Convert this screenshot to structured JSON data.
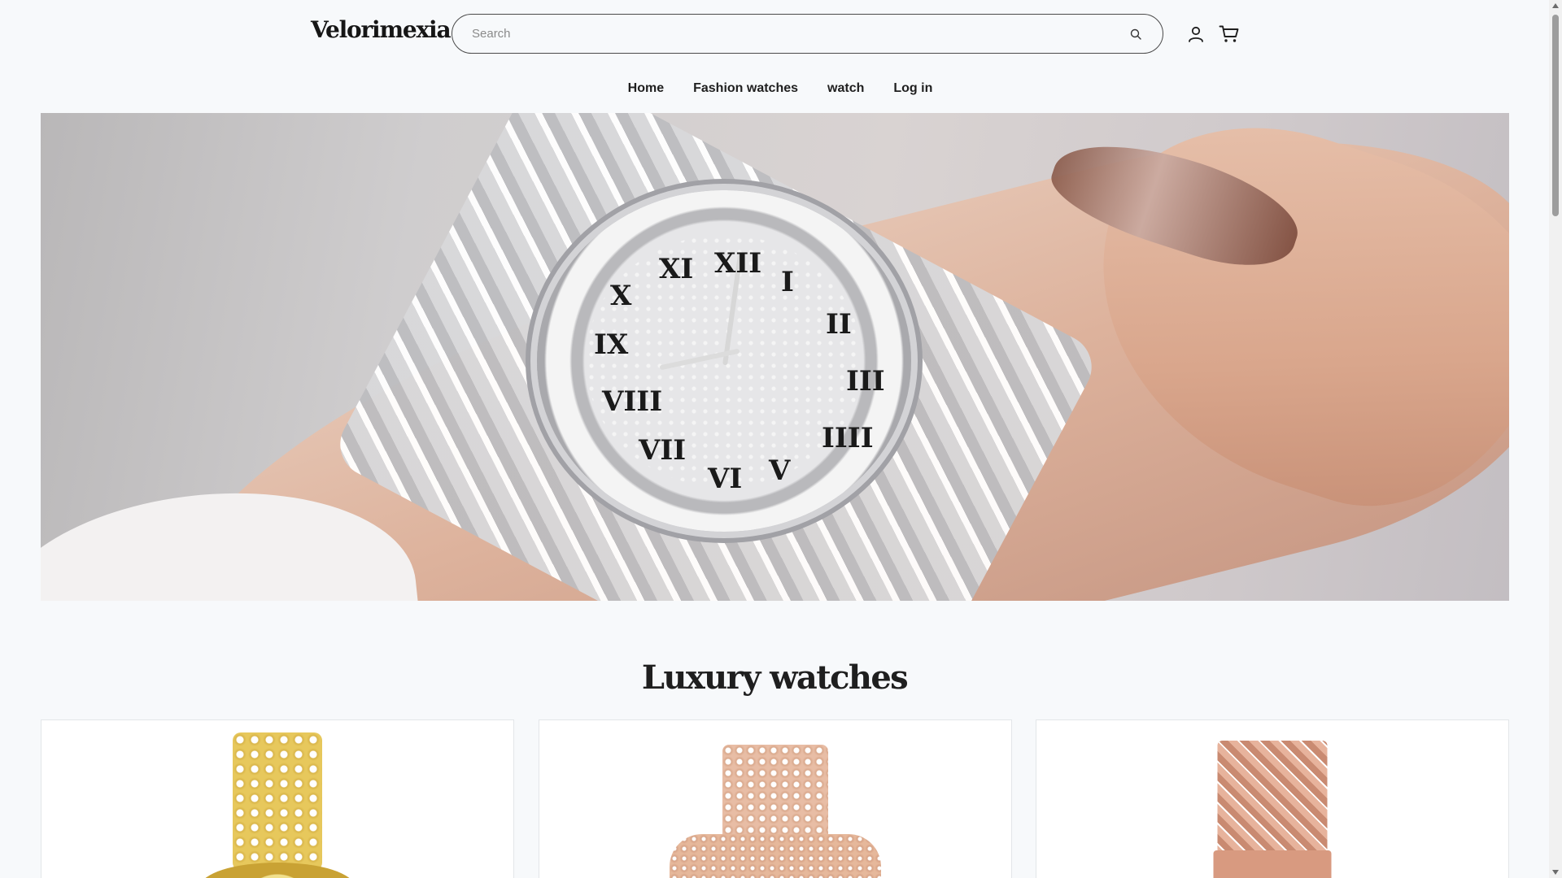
{
  "brand": {
    "logo_text": "Velorimexia"
  },
  "search": {
    "placeholder": "Search",
    "value": "",
    "icon": "search-icon"
  },
  "header_icons": {
    "account": "user-icon",
    "cart": "cart-icon"
  },
  "nav": {
    "items": [
      {
        "label": "Home"
      },
      {
        "label": "Fashion watches"
      },
      {
        "label": "watch"
      },
      {
        "label": "Log in"
      }
    ]
  },
  "hero": {
    "image": "hero-watch-image",
    "numerals": [
      "I",
      "II",
      "III",
      "IIII",
      "V",
      "VI",
      "VII",
      "VIII",
      "IX",
      "X",
      "XI",
      "XII"
    ]
  },
  "section": {
    "title": "Luxury watches"
  },
  "products": [
    {
      "image": "gold-diamond-watch-image"
    },
    {
      "image": "rose-gold-square-watch-image"
    },
    {
      "image": "rose-gold-bracelet-watch-image"
    }
  ],
  "colors": {
    "background": "#f7f9fb",
    "text": "#1f1f1f",
    "card_background": "#ffffff",
    "card_border": "#e3e6e9",
    "search_border": "#4a4a4a"
  }
}
